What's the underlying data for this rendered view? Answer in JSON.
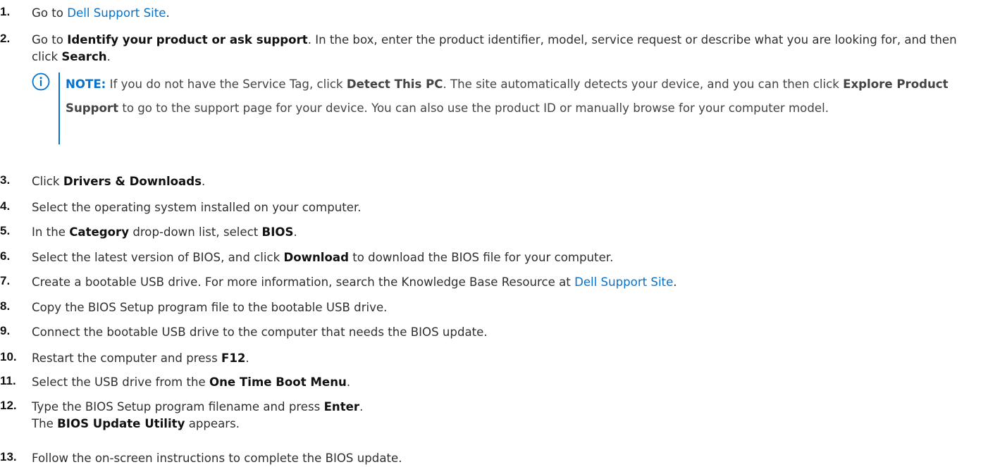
{
  "steps": [
    {
      "num": "1.",
      "parts": [
        {
          "t": "Go to "
        },
        {
          "t": "Dell Support Site",
          "link": true
        },
        {
          "t": "."
        }
      ]
    },
    {
      "num": "2.",
      "parts": [
        {
          "t": "Go to "
        },
        {
          "t": "Identify your product or ask support",
          "b": true
        },
        {
          "t": ". In the box, enter the product identifier, model, service request or describe what you are looking for, and then click "
        },
        {
          "t": "Search",
          "b": true
        },
        {
          "t": "."
        }
      ],
      "note": {
        "label": "NOTE:",
        "icon": "info-icon",
        "parts": [
          {
            "t": " If you do not have the Service Tag, click "
          },
          {
            "t": "Detect This PC",
            "b": true
          },
          {
            "t": ". The site automatically detects your device, and you can then click "
          },
          {
            "t": "Explore Product Support",
            "b": true
          },
          {
            "t": " to go to the support page for your device. You can also use the product ID or manually browse for your computer model."
          }
        ]
      }
    },
    {
      "num": "3.",
      "parts": [
        {
          "t": "Click "
        },
        {
          "t": "Drivers & Downloads",
          "b": true
        },
        {
          "t": "."
        }
      ]
    },
    {
      "num": "4.",
      "parts": [
        {
          "t": "Select the operating system installed on your computer."
        }
      ]
    },
    {
      "num": "5.",
      "parts": [
        {
          "t": "In the "
        },
        {
          "t": "Category",
          "b": true
        },
        {
          "t": " drop-down list, select "
        },
        {
          "t": "BIOS",
          "b": true
        },
        {
          "t": "."
        }
      ]
    },
    {
      "num": "6.",
      "parts": [
        {
          "t": "Select the latest version of BIOS, and click "
        },
        {
          "t": "Download",
          "b": true
        },
        {
          "t": " to download the BIOS file for your computer."
        }
      ]
    },
    {
      "num": "7.",
      "parts": [
        {
          "t": "Create a bootable USB drive. For more information, search the Knowledge Base Resource at "
        },
        {
          "t": "Dell Support Site",
          "link": true
        },
        {
          "t": "."
        }
      ]
    },
    {
      "num": "8.",
      "parts": [
        {
          "t": "Copy the BIOS Setup program file to the bootable USB drive."
        }
      ]
    },
    {
      "num": "9.",
      "parts": [
        {
          "t": "Connect the bootable USB drive to the computer that needs the BIOS update."
        }
      ]
    },
    {
      "num": "10.",
      "parts": [
        {
          "t": "Restart the computer and press "
        },
        {
          "t": "F12",
          "b": true
        },
        {
          "t": "."
        }
      ]
    },
    {
      "num": "11.",
      "parts": [
        {
          "t": "Select the USB drive from the "
        },
        {
          "t": "One Time Boot Menu",
          "b": true
        },
        {
          "t": "."
        }
      ]
    },
    {
      "num": "12.",
      "parts": [
        {
          "t": "Type the BIOS Setup program filename and press "
        },
        {
          "t": "Enter",
          "b": true
        },
        {
          "t": "."
        },
        {
          "br": true
        },
        {
          "t": "The "
        },
        {
          "t": "BIOS Update Utility",
          "b": true
        },
        {
          "t": " appears."
        }
      ]
    },
    {
      "num": "13.",
      "parts": [
        {
          "t": "Follow the on-screen instructions to complete the BIOS update."
        }
      ]
    }
  ],
  "colors": {
    "link": "#0672cb",
    "text": "#2f2f2f",
    "note_bar": "#0672cb"
  }
}
